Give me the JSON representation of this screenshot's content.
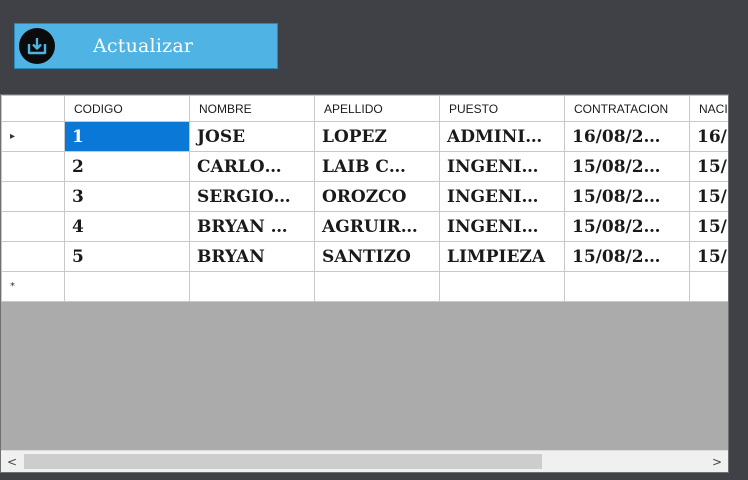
{
  "toolbar": {
    "refresh_label": "Actualizar"
  },
  "grid": {
    "columns": [
      "CODIGO",
      "NOMBRE",
      "APELLIDO",
      "PUESTO",
      "CONTRATACION",
      "NACI"
    ],
    "rows": [
      [
        "1",
        "JOSE",
        "LOPEZ",
        "ADMINI…",
        "16/08/2…",
        "16/"
      ],
      [
        "2",
        "CARLO…",
        "LAIB C…",
        "INGENI…",
        "15/08/2…",
        "15/"
      ],
      [
        "3",
        "SERGIO…",
        "OROZCO",
        "INGENI…",
        "15/08/2…",
        "15/"
      ],
      [
        "4",
        "BRYAN …",
        "AGRUIR…",
        "INGENI…",
        "15/08/2…",
        "15/"
      ],
      [
        "5",
        "BRYAN",
        "SANTIZO",
        "LIMPIEZA",
        "15/08/2…",
        "15/"
      ]
    ],
    "current_row_marker": "▸",
    "new_row_marker": "*",
    "selected_cell": {
      "row": 0,
      "column": 0
    },
    "scroll_left_glyph": "<",
    "scroll_right_glyph": ">",
    "horizontal_scroll_fraction": 0.76
  },
  "colors": {
    "background": "#3f4147",
    "button": "#4fb3e4",
    "selection": "#0a78d7",
    "empty_area": "#ababab"
  }
}
